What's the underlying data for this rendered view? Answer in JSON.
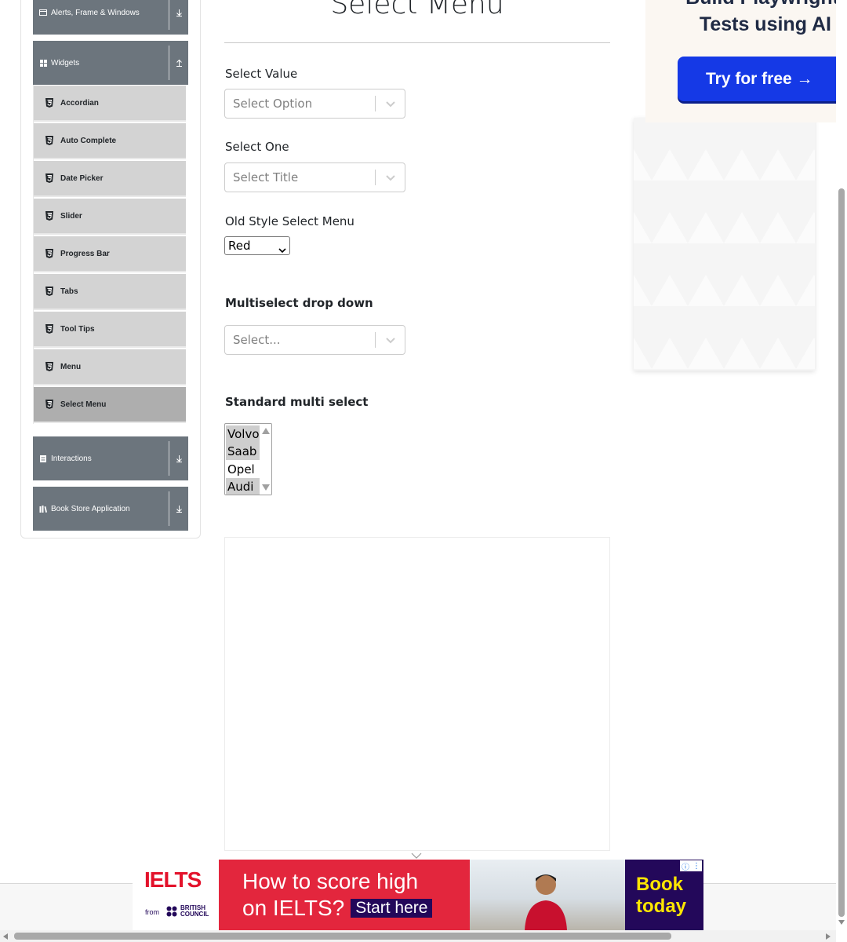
{
  "sidebar": {
    "groups": [
      {
        "label": "Alerts, Frame & Windows",
        "arrow": "down"
      },
      {
        "label": "Widgets",
        "arrow": "up"
      },
      {
        "label": "Interactions",
        "arrow": "down"
      },
      {
        "label": "Book Store Application",
        "arrow": "down"
      }
    ],
    "widget_items": [
      {
        "label": "Accordian"
      },
      {
        "label": "Auto Complete"
      },
      {
        "label": "Date Picker"
      },
      {
        "label": "Slider"
      },
      {
        "label": "Progress Bar"
      },
      {
        "label": "Tabs"
      },
      {
        "label": "Tool Tips"
      },
      {
        "label": "Menu"
      },
      {
        "label": "Select Menu",
        "active": true
      }
    ]
  },
  "main": {
    "title": "Select Menu",
    "select_value": {
      "label": "Select Value",
      "placeholder": "Select Option"
    },
    "select_one": {
      "label": "Select One",
      "placeholder": "Select Title"
    },
    "old_style": {
      "label": "Old Style Select Menu",
      "value": "Red"
    },
    "multiselect": {
      "label": "Multiselect drop down",
      "placeholder": "Select..."
    },
    "standard_multi": {
      "label": "Standard multi select",
      "options": [
        {
          "label": "Volvo",
          "selected": true
        },
        {
          "label": "Saab",
          "selected": true
        },
        {
          "label": "Opel",
          "selected": false
        },
        {
          "label": "Audi",
          "selected": true
        }
      ]
    }
  },
  "side_ad": {
    "headline_line1": "Build Playwright",
    "headline_line2": "Tests using AI",
    "button_label": "Try for free →",
    "button_color": "#1539e6"
  },
  "bottom_ad": {
    "brand": "IELTS",
    "from_text": "from",
    "partner_line1": "BRITISH",
    "partner_line2": "COUNCIL",
    "headline_line1": "How to score high",
    "headline_line2": "on IELTS?",
    "cta": "Start here",
    "book_line1": "Book",
    "book_line2": "today",
    "brand_color": "#e3263d"
  },
  "colors": {
    "group_header": "#6c757d",
    "menu_item": "#d3d3d3",
    "menu_item_active": "#aeaeae"
  }
}
